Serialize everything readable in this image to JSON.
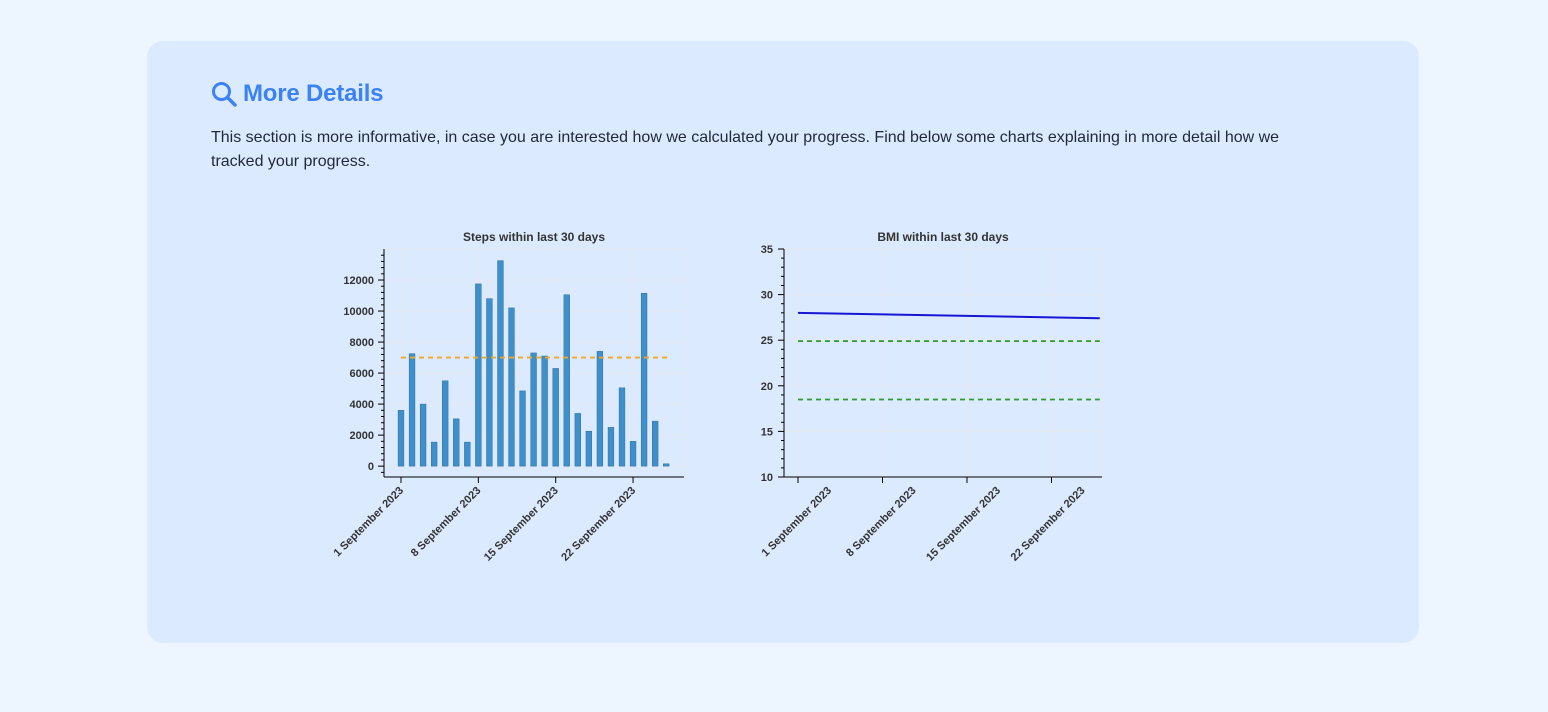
{
  "section": {
    "title": "More Details",
    "icon": "search-icon",
    "description": "This section is more informative, in case you are interested how we calculated your progress. Find below some charts explaining in more detail how we tracked your progress."
  },
  "colors": {
    "accent": "#3b82f6",
    "bar": "#3f8fcb",
    "goal_line": "#f5a623",
    "bmi_line": "#1515d6",
    "bmi_band": "#2e9b2e"
  },
  "chart_data": [
    {
      "type": "bar",
      "title": "Steps within last 30 days",
      "xlabel": "",
      "ylabel": "",
      "x": [
        "2023-09-01",
        "2023-09-02",
        "2023-09-03",
        "2023-09-04",
        "2023-09-05",
        "2023-09-06",
        "2023-09-07",
        "2023-09-08",
        "2023-09-09",
        "2023-09-10",
        "2023-09-11",
        "2023-09-12",
        "2023-09-13",
        "2023-09-14",
        "2023-09-15",
        "2023-09-16",
        "2023-09-17",
        "2023-09-18",
        "2023-09-19",
        "2023-09-20",
        "2023-09-21",
        "2023-09-22",
        "2023-09-23",
        "2023-09-24",
        "2023-09-25",
        "2023-09-26"
      ],
      "values": [
        3600,
        7250,
        4000,
        1550,
        5500,
        3050,
        1550,
        11750,
        10800,
        13250,
        10200,
        4850,
        7300,
        7100,
        6300,
        11050,
        3400,
        2250,
        7400,
        2500,
        5050,
        1600,
        11150,
        2900,
        150
      ],
      "reference_line": {
        "value": 7000,
        "style": "dashed"
      },
      "x_ticks": [
        "1 September 2023",
        "8 September 2023",
        "15 September 2023",
        "22 September 2023"
      ],
      "y_ticks": [
        "0",
        "2000",
        "4000",
        "6000",
        "8000",
        "10000",
        "12000"
      ],
      "ylim": [
        -700,
        14000
      ],
      "grid": true
    },
    {
      "type": "line",
      "title": "BMI within last 30 days",
      "xlabel": "",
      "ylabel": "",
      "x": [
        "2023-09-01",
        "2023-09-26"
      ],
      "series": [
        {
          "values": [
            28.0,
            27.4
          ]
        }
      ],
      "reference_lines": [
        {
          "value": 24.9,
          "style": "dashed"
        },
        {
          "value": 18.5,
          "style": "dashed"
        }
      ],
      "x_ticks": [
        "1 September 2023",
        "8 September 2023",
        "15 September 2023",
        "22 September 2023"
      ],
      "y_ticks": [
        "10",
        "15",
        "20",
        "25",
        "30",
        "35"
      ],
      "ylim": [
        10,
        35
      ],
      "grid": true
    }
  ]
}
